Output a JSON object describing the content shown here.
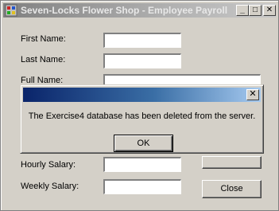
{
  "window": {
    "title": "Seven-Locks Flower Shop - Employee Payroll",
    "controls": {
      "minimize": "_",
      "maximize": "□",
      "close": "✕"
    }
  },
  "form": {
    "first_name_label": "First Name:",
    "first_name_value": "",
    "last_name_label": "Last Name:",
    "last_name_value": "",
    "full_name_label": "Full Name:",
    "full_name_value": "",
    "hourly_salary_label": "Hourly Salary:",
    "hourly_salary_value": "",
    "weekly_salary_label": "Weekly Salary:",
    "weekly_salary_value": "",
    "close_label": "Close"
  },
  "dialog": {
    "title": "",
    "close_glyph": "✕",
    "message": "The Exercise4 database has been deleted from the server.",
    "ok_label": "OK"
  },
  "colors": {
    "face": "#d4d0c8",
    "dialog_title_start": "#0a246a",
    "dialog_title_end": "#a6caf0"
  }
}
